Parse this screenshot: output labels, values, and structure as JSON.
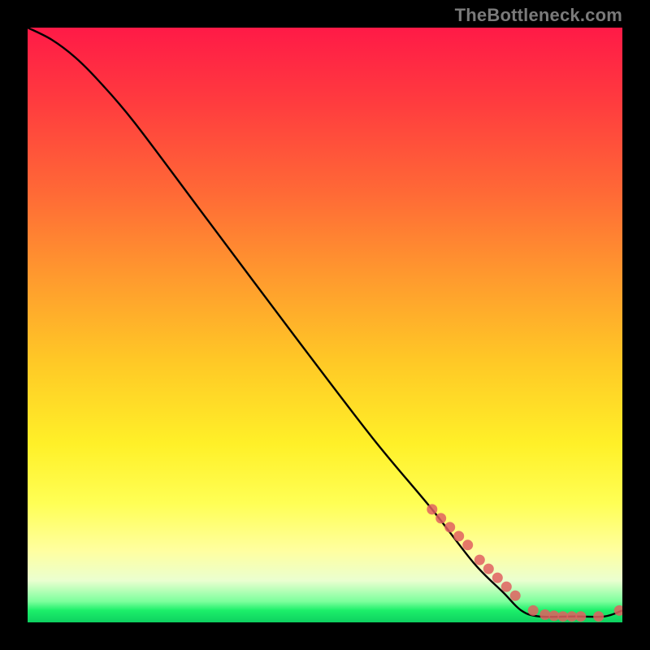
{
  "watermark": "TheBottleneck.com",
  "chart_data": {
    "type": "line",
    "title": "",
    "xlabel": "",
    "ylabel": "",
    "xlim": [
      0,
      100
    ],
    "ylim": [
      0,
      100
    ],
    "grid": false,
    "legend": false,
    "series": [
      {
        "name": "curve",
        "color": "#000000",
        "x": [
          0,
          4,
          8,
          12,
          18,
          30,
          45,
          58,
          68,
          75,
          80,
          83,
          86,
          92,
          97,
          100
        ],
        "y": [
          100,
          98,
          95,
          91,
          84,
          68,
          48,
          31,
          19,
          10,
          5,
          2,
          1,
          1,
          1,
          2
        ]
      },
      {
        "name": "highlight-dots",
        "color": "#e06060",
        "type": "scatter",
        "x": [
          68,
          69.5,
          71,
          72.5,
          74,
          76,
          77.5,
          79,
          80.5,
          82,
          85,
          87,
          88.5,
          90,
          91.5,
          93,
          96,
          99.5
        ],
        "y": [
          19,
          17.5,
          16,
          14.5,
          13,
          10.5,
          9,
          7.5,
          6,
          4.5,
          2,
          1.3,
          1.1,
          1,
          1,
          1,
          1,
          2
        ]
      }
    ]
  },
  "colors": {
    "background": "#000000",
    "curve": "#000000",
    "dot": "#e06060"
  }
}
